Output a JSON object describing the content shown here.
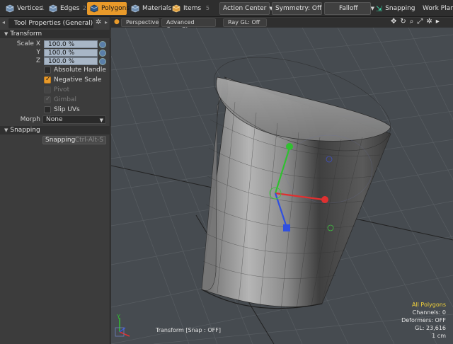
{
  "toolbar": {
    "vertices": {
      "label": "Vertices",
      "num": "1"
    },
    "edges": {
      "label": "Edges",
      "num": "2"
    },
    "polygons": {
      "label": "Polygons",
      "num": "3"
    },
    "materials": {
      "label": "Materials",
      "num": "4"
    },
    "items": {
      "label": "Items",
      "num": "5"
    },
    "action_center": "Action Center",
    "symmetry": "Symmetry: Off",
    "falloff": "Falloff",
    "snapping": "Snapping",
    "work_plane": "Work Plane"
  },
  "panel": {
    "title": "Tool Properties (General)",
    "transform_section": "Transform",
    "scale_x_label": "Scale X",
    "y_label": "Y",
    "z_label": "Z",
    "scale_x": "100.0 %",
    "scale_y": "100.0 %",
    "scale_z": "100.0 %",
    "absolute_handle": "Absolute Handle",
    "negative_scale": "Negative Scale",
    "pivot": "Pivot",
    "gimbal": "Gimbal",
    "slip_uvs": "Slip UVs",
    "morph_label": "Morph",
    "morph_value": "None",
    "snapping_section": "Snapping",
    "snapping_button": "Snapping",
    "snapping_shortcut": "Ctrl-Alt-S"
  },
  "viewport": {
    "tab_perspective": "Perspective",
    "tab_opengl": "Advanced OpenGL",
    "tab_raygl": "Ray GL: Off",
    "hud_all_polygons": "All Polygons",
    "hud_channels": "Channels: 0",
    "hud_deformers": "Deformers: OFF",
    "hud_gl": "GL: 23,616",
    "hud_units": "1 cm",
    "status": "Transform  [Snap : OFF]",
    "axis_y": "Y"
  },
  "colors": {
    "accent": "#e99a2a",
    "gizmo_x": "#e03030",
    "gizmo_y": "#30c030",
    "gizmo_z": "#3050e0",
    "hud_highlight": "#f2d23a"
  }
}
